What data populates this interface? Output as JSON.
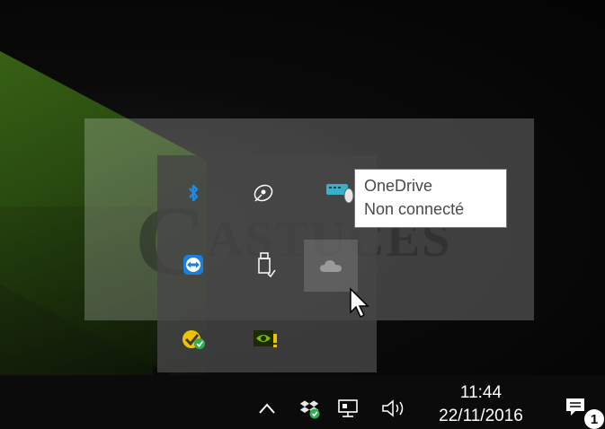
{
  "watermark": {
    "text": "ASTUCES",
    "initial": "C"
  },
  "tooltip": {
    "title": "OneDrive",
    "status": "Non connecté"
  },
  "tray": {
    "icons": [
      {
        "name": "bluetooth-icon",
        "color": "#1e8ae6"
      },
      {
        "name": "network-satellite-icon",
        "color": "#ffffff"
      },
      {
        "name": "keyboard-mouse-icon",
        "color": "#3ab0c8"
      },
      {
        "name": "teamviewer-icon",
        "color": "#1b7fe0"
      },
      {
        "name": "usb-safely-remove-icon",
        "color": "#ffffff"
      },
      {
        "name": "onedrive-cloud-icon",
        "color": "#9a9a9a"
      },
      {
        "name": "norton-check-icon",
        "color": "#f2c200"
      },
      {
        "name": "nvidia-warning-icon",
        "color": "#76b900"
      }
    ]
  },
  "taskbar": {
    "chevron": "^",
    "clock_time": "11:44",
    "clock_date": "22/11/2016",
    "notification_count": "1"
  }
}
